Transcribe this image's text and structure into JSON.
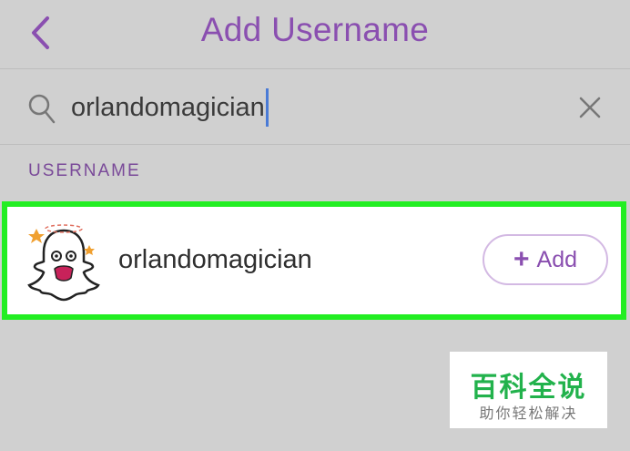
{
  "header": {
    "title": "Add Username",
    "back_icon": "chevron-left-icon"
  },
  "search": {
    "value": "orlandomagician",
    "search_icon": "search-icon",
    "clear_icon": "close-icon"
  },
  "section": {
    "label": "USERNAME"
  },
  "result": {
    "username": "orlandomagician",
    "avatar_icon": "snapchat-ghost-avatar-icon",
    "add_label": "Add",
    "add_icon": "plus-icon"
  },
  "watermark": {
    "main": "百科全说",
    "sub": "助你轻松解决"
  },
  "colors": {
    "background": "#d0d0d0",
    "accent": "#8a4fb0",
    "highlight_border": "#22ee22",
    "watermark_green": "#22b24c"
  }
}
